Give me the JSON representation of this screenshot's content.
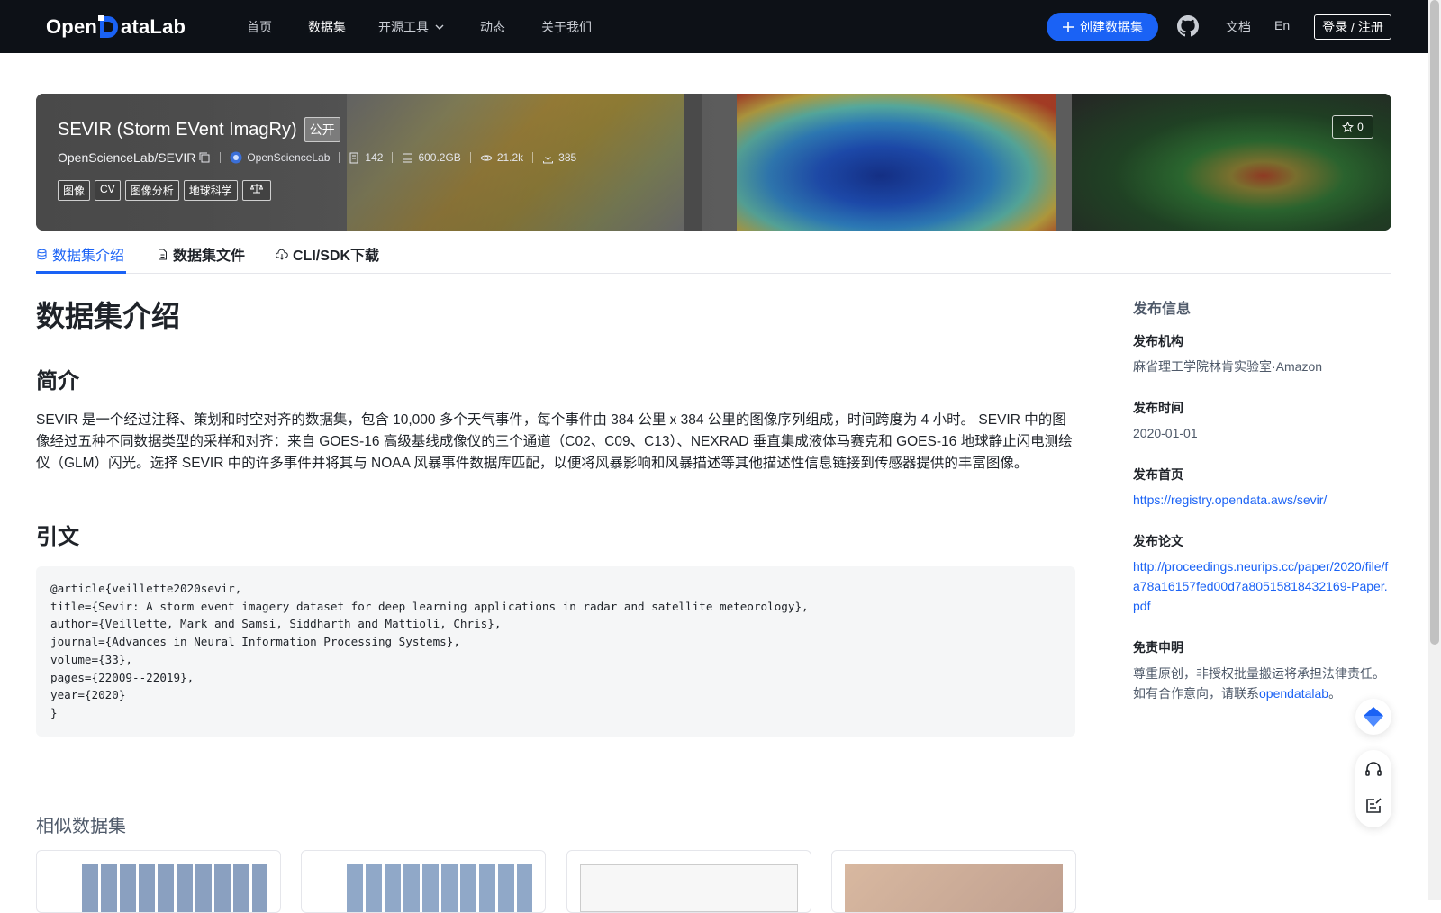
{
  "nav": {
    "logo_text_left": "Open",
    "logo_text_right": "ataLab",
    "items": [
      {
        "label": "首页"
      },
      {
        "label": "数据集"
      },
      {
        "label": "开源工具"
      },
      {
        "label": "动态"
      },
      {
        "label": "关于我们"
      }
    ],
    "create_label": "创建数据集",
    "docs_label": "文档",
    "lang_label": "En",
    "login_label": "登录 / 注册"
  },
  "banner": {
    "title": "SEVIR (Storm EVent ImagRy)",
    "visibility": "公开",
    "path": "OpenScienceLab/SEVIR",
    "org": "OpenScienceLab",
    "files": "142",
    "size": "600.2GB",
    "views": "21.2k",
    "downloads": "385",
    "tags": [
      "图像",
      "CV",
      "图像分析",
      "地球科学"
    ],
    "stars": "0"
  },
  "tabs": [
    {
      "label": "数据集介绍"
    },
    {
      "label": "数据集文件"
    },
    {
      "label": "CLI/SDK下载"
    }
  ],
  "main": {
    "title": "数据集介绍",
    "intro_heading": "简介",
    "intro_text": "SEVIR 是一个经过注释、策划和时空对齐的数据集，包含 10,000 多个天气事件，每个事件由 384 公里 x 384 公里的图像序列组成，时间跨度为 4 小时。 SEVIR 中的图像经过五种不同数据类型的采样和对齐：来自 GOES-16 高级基线成像仪的三个通道（C02、C09、C13）、NEXRAD 垂直集成液体马赛克和 GOES-16 地球静止闪电测绘仪（GLM）闪光。选择 SEVIR 中的许多事件并将其与 NOAA 风暴事件数据库匹配，以便将风暴影响和风暴描述等其他描述性信息链接到传感器提供的丰富图像。",
    "citation_heading": "引文",
    "citation": "@article{veillette2020sevir,\ntitle={Sevir: A storm event imagery dataset for deep learning applications in radar and satellite meteorology},\nauthor={Veillette, Mark and Samsi, Siddharth and Mattioli, Chris},\njournal={Advances in Neural Information Processing Systems},\nvolume={33},\npages={22009--22019},\nyear={2020}\n}",
    "similar_heading": "相似数据集"
  },
  "sidebar": {
    "title": "发布信息",
    "org_label": "发布机构",
    "org_value": "麻省理工学院林肯实验室·Amazon",
    "date_label": "发布时间",
    "date_value": "2020-01-01",
    "homepage_label": "发布首页",
    "homepage_value": "https://registry.opendata.aws/sevir/",
    "paper_label": "发布论文",
    "paper_value": "http://proceedings.neurips.cc/paper/2020/file/fa78a16157fed00d7a80515818432169-Paper.pdf",
    "disclaimer_label": "免责申明",
    "disclaimer_line1": "尊重原创，非授权批量搬运将承担法律责任。",
    "disclaimer_line2_prefix": "如有合作意向，请联系",
    "disclaimer_link": "opendatalab",
    "disclaimer_suffix": "。"
  },
  "colors": {
    "nav_bg": "#0d1117",
    "accent": "#1a62f5",
    "text": "#1f2329",
    "muted": "#4e5969"
  }
}
